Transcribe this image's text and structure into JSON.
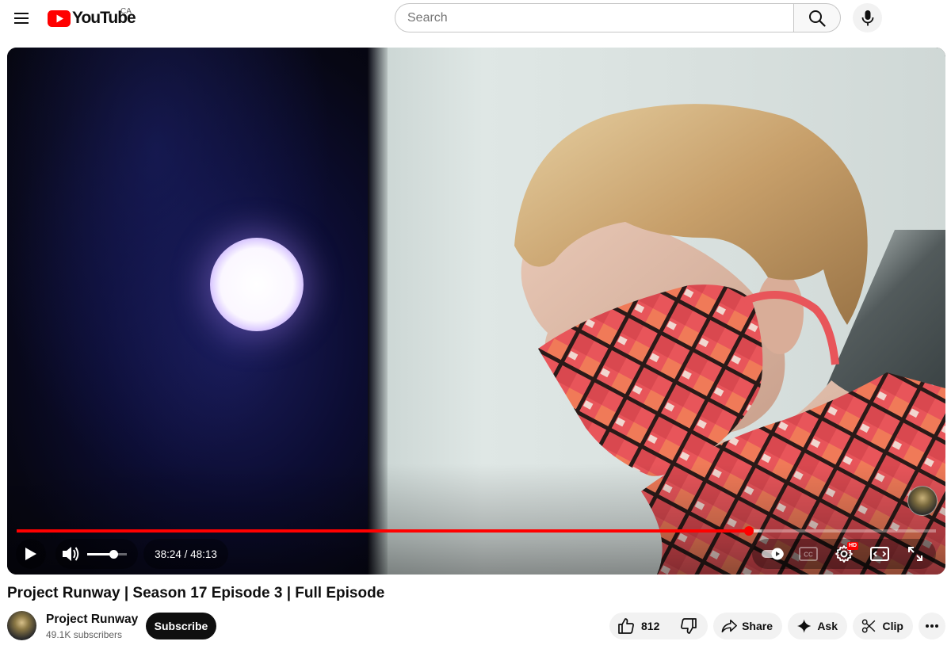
{
  "header": {
    "logo_text": "YouTube",
    "country_code": "CA",
    "search_placeholder": "Search",
    "brand_color": "#ff0000"
  },
  "player": {
    "current_time": "38:24",
    "duration": "48:13",
    "time_display": "38:24 / 48:13",
    "progress_fraction": 0.7965,
    "buffer_fraction": 0.81,
    "volume_fraction": 0.65,
    "quality_badge": "HD",
    "controls": {
      "play": "play-icon",
      "volume": "volume-icon",
      "autoplay": "autoplay-toggle-icon",
      "captions": "captions-icon",
      "settings": "settings-icon",
      "theater": "theater-mode-icon",
      "fullscreen": "fullscreen-icon"
    }
  },
  "video": {
    "title": "Project Runway | Season 17 Episode 3 | Full Episode"
  },
  "channel": {
    "name": "Project Runway",
    "subscribers": "49.1K subscribers",
    "subscribe_label": "Subscribe"
  },
  "actions": {
    "like_count": "812",
    "share_label": "Share",
    "ask_label": "Ask",
    "clip_label": "Clip"
  }
}
